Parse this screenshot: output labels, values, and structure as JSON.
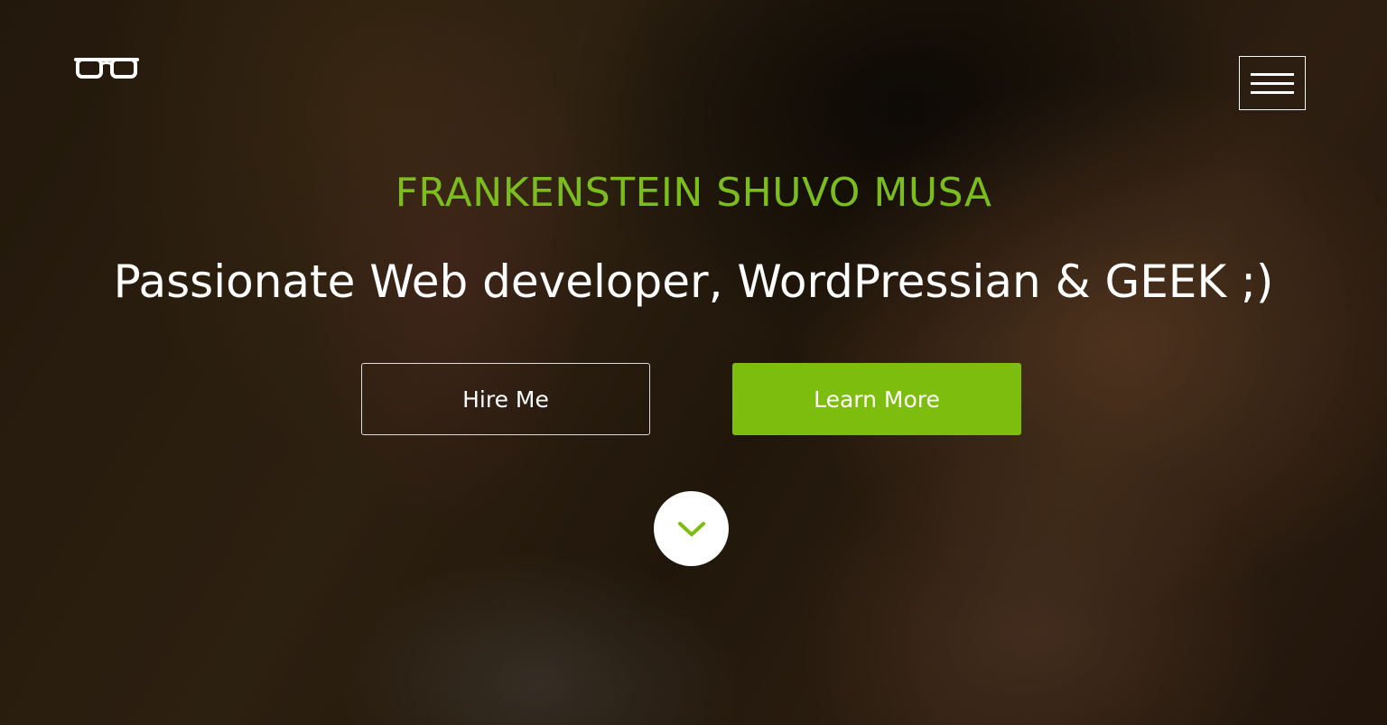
{
  "brand": {
    "logo_icon": "glasses-icon"
  },
  "nav": {
    "menu_icon": "hamburger-menu-icon"
  },
  "hero": {
    "name": "FRANKENSTEIN SHUVO MUSA",
    "tagline": "Passionate Web developer, WordPressian & GEEK ;)",
    "hire_button_label": "Hire Me",
    "learn_button_label": "Learn More",
    "scroll_icon": "chevron-down-icon"
  },
  "colors": {
    "accent": "#7cbd0d",
    "text": "#ffffff"
  }
}
